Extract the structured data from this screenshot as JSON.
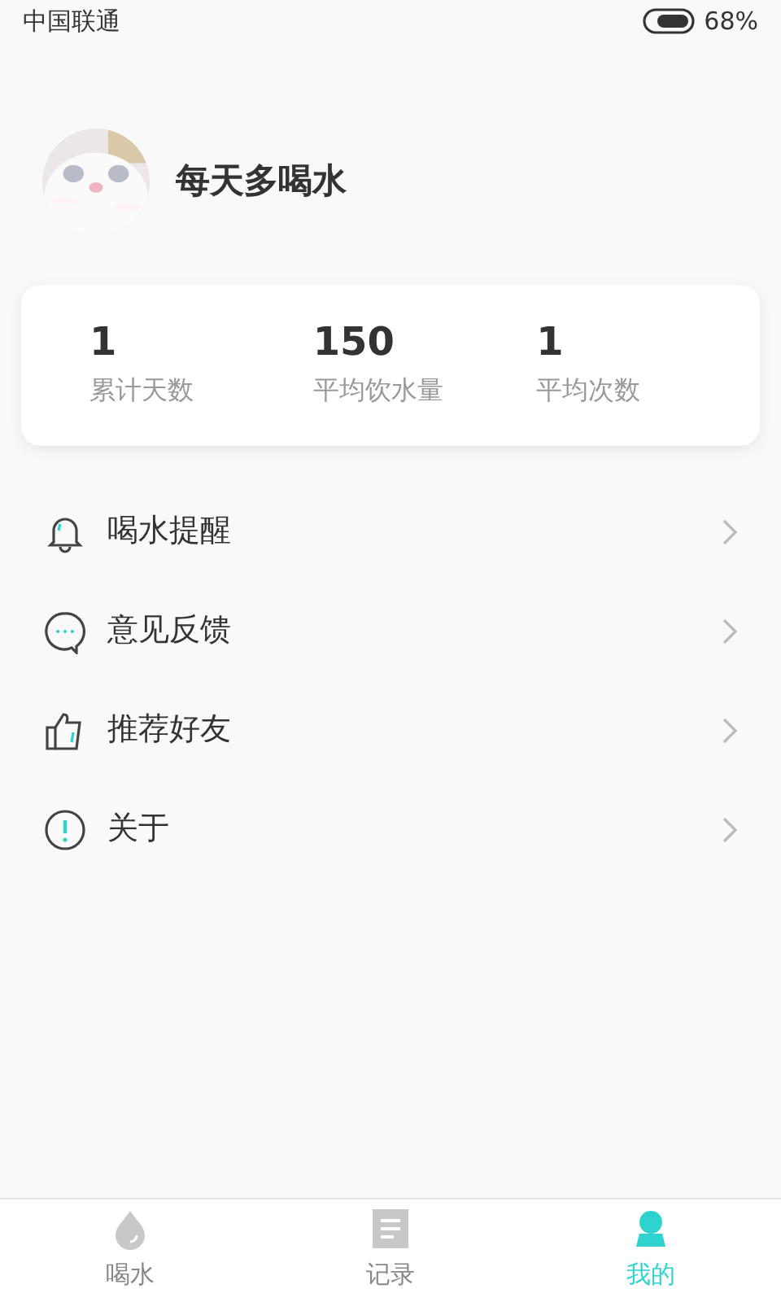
{
  "status_bar": {
    "carrier": "中国联通",
    "battery": "68%"
  },
  "profile": {
    "name": "每天多喝水"
  },
  "stats": [
    {
      "value": "1",
      "label": "累计天数"
    },
    {
      "value": "150",
      "label": "平均饮水量"
    },
    {
      "value": "1",
      "label": "平均次数"
    }
  ],
  "menu": [
    {
      "kind": "bell",
      "label": "喝水提醒"
    },
    {
      "kind": "chat",
      "label": "意见反馈"
    },
    {
      "kind": "thumb",
      "label": "推荐好友"
    },
    {
      "kind": "info",
      "label": "关于"
    }
  ],
  "tab_bar": [
    {
      "kind": "drop",
      "label": "喝水",
      "selected": false
    },
    {
      "kind": "list",
      "label": "记录",
      "selected": false
    },
    {
      "kind": "user",
      "label": "我的",
      "selected": true
    }
  ]
}
